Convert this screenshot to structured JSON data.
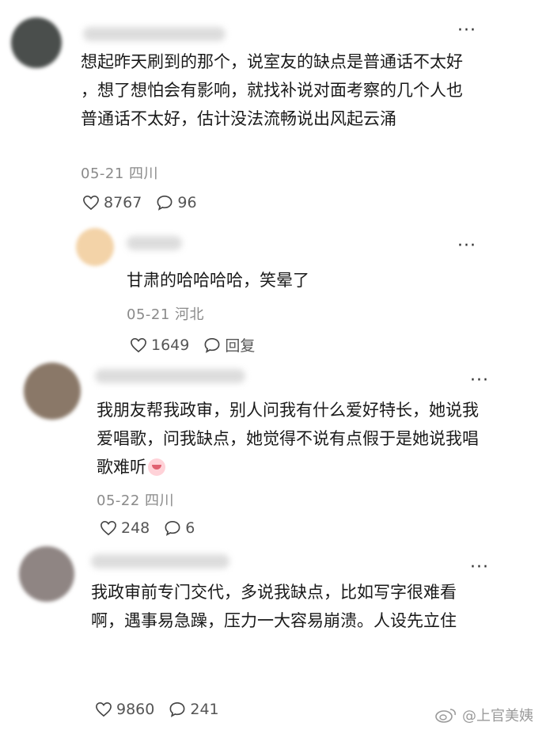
{
  "comments": [
    {
      "text": "想起昨天刷到的那个，说室友的缺点是普通话不太好 ，想了想怕会有影响，就找补说对面考察的几个人也普通话不太好，估计没法流畅说出风起云涌",
      "meta": "05-21 四川",
      "likes": "8767",
      "replies": "96",
      "avatar_color": "#4a4e4c"
    },
    {
      "text": "甘肃的哈哈哈哈，笑晕了",
      "meta": "05-21 河北",
      "likes": "1649",
      "replies": "回复",
      "avatar_color": "#f3d3a8"
    },
    {
      "text": "我朋友帮我政审，别人问我有什么爱好特长，她说我爱唱歌，问我缺点，她觉得不说有点假于是她说我唱歌难听",
      "meta": "05-22 四川",
      "likes": "248",
      "replies": "6",
      "avatar_color": "#8a7868"
    },
    {
      "text": "我政审前专门交代，多说我缺点，比如写字很难看啊，遇事易急躁，压力一大容易崩溃。人设先立住",
      "likes": "9860",
      "replies": "241",
      "avatar_color": "#8f8583"
    }
  ],
  "more_glyph": "···",
  "watermark": "@上官美姨"
}
